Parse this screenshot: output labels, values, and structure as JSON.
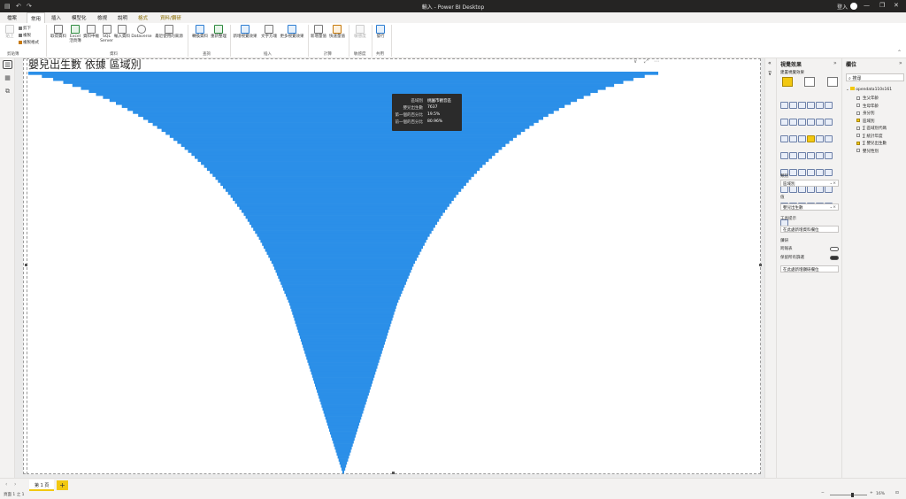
{
  "window": {
    "title": "輸入 - Power BI Desktop",
    "login": "登入"
  },
  "tabs": [
    "檔案",
    "常用",
    "插入",
    "模型化",
    "檢視",
    "說明",
    "格式",
    "資料/鑽研"
  ],
  "ribbon": {
    "clipboard": {
      "paste": "貼上",
      "cut": "剪下",
      "copy": "複製",
      "format_painter": "複製格式",
      "group": "剪貼簿"
    },
    "data": {
      "items": [
        "取得資料",
        "Excel 活頁簿",
        "資料中樞",
        "SQL Server",
        "輸入資料",
        "Dataverse",
        "最近使用的來源"
      ],
      "group": "資料"
    },
    "queries": {
      "items": [
        "轉換資料",
        "重新整理"
      ],
      "group": "查詢"
    },
    "insert": {
      "items": [
        "新增視覺效果",
        "文字方塊",
        "更多視覺效果"
      ],
      "group": "插入"
    },
    "calc": {
      "items": [
        "新增量值",
        "快速量值"
      ],
      "group": "計算"
    },
    "sensitivity": {
      "items": [
        "敏感度"
      ],
      "group": "敏感度"
    },
    "share": {
      "items": [
        "發行"
      ],
      "group": "共用"
    }
  },
  "visual": {
    "title": "嬰兒出生數 依據 區域別",
    "tooltip": [
      {
        "key": "區域別",
        "value": "桃園市觀音區"
      },
      {
        "key": "嬰兒出生數",
        "value": "7637"
      },
      {
        "key": "第一個的百分比",
        "value": "19.5%"
      },
      {
        "key": "前一個的百分比",
        "value": "80.96%"
      }
    ]
  },
  "chart_data": {
    "type": "bar",
    "orientation": "funnel",
    "color": "#2b8fe8",
    "title": "嬰兒出生數 依據 區域別",
    "grid": false,
    "series": [
      {
        "name": "嬰兒出生數",
        "values_fraction_of_first": [
          1.0,
          0.957,
          0.921,
          0.889,
          0.86,
          0.833,
          0.808,
          0.785,
          0.763,
          0.742,
          0.722,
          0.703,
          0.685,
          0.668,
          0.651,
          0.635,
          0.62,
          0.605,
          0.591,
          0.577,
          0.564,
          0.551,
          0.539,
          0.527,
          0.515,
          0.504,
          0.493,
          0.482,
          0.472,
          0.462,
          0.452,
          0.442,
          0.433,
          0.424,
          0.415,
          0.406,
          0.398,
          0.39,
          0.382,
          0.374,
          0.366,
          0.358,
          0.351,
          0.344,
          0.337,
          0.33,
          0.323,
          0.316,
          0.31,
          0.304,
          0.298,
          0.292,
          0.286,
          0.28,
          0.274,
          0.268,
          0.263,
          0.258,
          0.253,
          0.248,
          0.243,
          0.238,
          0.233,
          0.228,
          0.223,
          0.219,
          0.215,
          0.211,
          0.207,
          0.203,
          0.199,
          0.195,
          0.191,
          0.187,
          0.183,
          0.179,
          0.175,
          0.171,
          0.168,
          0.165,
          0.162,
          0.159,
          0.156,
          0.153,
          0.15,
          0.147,
          0.144,
          0.141,
          0.138,
          0.135,
          0.132,
          0.129,
          0.126,
          0.123,
          0.12,
          0.117,
          0.114,
          0.111,
          0.108,
          0.105,
          0.102,
          0.099,
          0.096,
          0.093,
          0.09,
          0.087,
          0.084,
          0.081,
          0.078,
          0.075,
          0.072,
          0.069,
          0.066,
          0.063,
          0.06,
          0.057,
          0.054,
          0.051,
          0.048,
          0.045,
          0.042,
          0.039,
          0.036,
          0.033,
          0.03,
          0.027,
          0.024,
          0.021,
          0.018,
          0.015,
          0.012,
          0.009,
          0.006,
          0.003
        ]
      }
    ]
  },
  "viz_pane": {
    "header": "視覺效果",
    "sub": "建置視覺效果",
    "category_label": "類別",
    "category_value": "區域別",
    "values_label": "值",
    "values_value": "嬰兒出生數",
    "tooltip_label": "工具提示",
    "tooltip_well": "在此處新增資料欄位",
    "drill_label": "鑽研",
    "cross_report": "跨報表",
    "keep_filters": "保留所有篩選",
    "drill_well": "在此處新增鑽研欄位"
  },
  "fields_pane": {
    "header": "欄位",
    "search_placeholder": "搜尋",
    "table": "opendata110s161",
    "items": [
      {
        "label": "生父年齡",
        "checked": false
      },
      {
        "label": "生母年齡",
        "checked": false
      },
      {
        "label": "身分別",
        "checked": false
      },
      {
        "label": "區域別",
        "checked": true
      },
      {
        "label": "∑ 區域別代碼",
        "checked": false
      },
      {
        "label": "∑ 統計年度",
        "checked": false
      },
      {
        "label": "∑ 嬰兒出生數",
        "checked": true
      },
      {
        "label": "嬰兒性別",
        "checked": false
      }
    ]
  },
  "pages": {
    "current": "第 1 頁",
    "add": "+"
  },
  "status": {
    "page_info": "頁面 1 之 1",
    "zoom": "16%"
  }
}
